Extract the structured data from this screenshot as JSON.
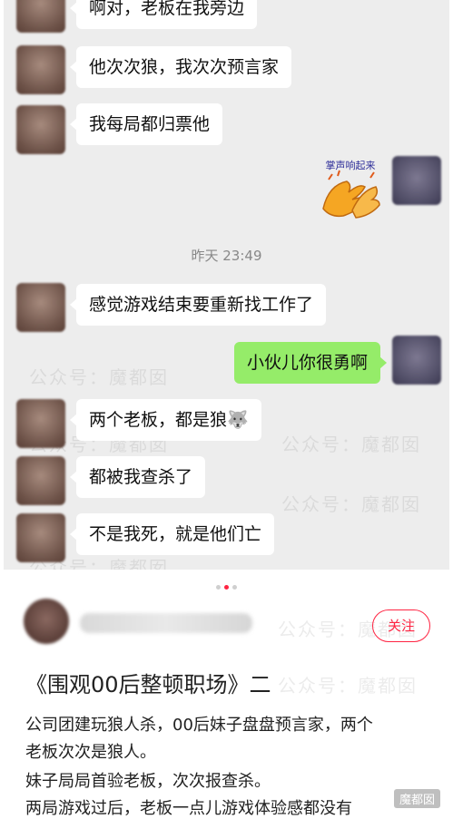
{
  "chat": {
    "messages": [
      {
        "side": "left",
        "text": "啊对，老板在我旁边"
      },
      {
        "side": "left",
        "text": "他次次狼，我次次预言家"
      },
      {
        "side": "left",
        "text": "我每局都归票他"
      },
      {
        "side": "right",
        "sticker_text": "掌声响起来"
      },
      {
        "timestamp": "昨天 23:49"
      },
      {
        "side": "left",
        "text": "感觉游戏结束要重新找工作了"
      },
      {
        "side": "right",
        "text": "小伙儿你很勇啊"
      },
      {
        "side": "left",
        "text": "两个老板，都是狼🐺"
      },
      {
        "side": "left",
        "text": "都被我查杀了"
      },
      {
        "side": "left",
        "text": "不是我死，就是他们亡"
      }
    ],
    "watermark": "公众号：魔都囡"
  },
  "post": {
    "follow_label": "关注",
    "title": "《围观00后整顿职场》二",
    "desc_lines": [
      "公司团建玩狼人杀，00后妹子盘盘预言家，两个",
      "老板次次是狼人。",
      "妹子局局首验老板，次次报查杀。",
      "两局游戏过后，老板一点儿游戏体验感都没有"
    ],
    "bottom_watermark": "魔都囡"
  },
  "colors": {
    "accent": "#ff2442",
    "bubble_green": "#95ec69",
    "chat_bg": "#ededed"
  }
}
